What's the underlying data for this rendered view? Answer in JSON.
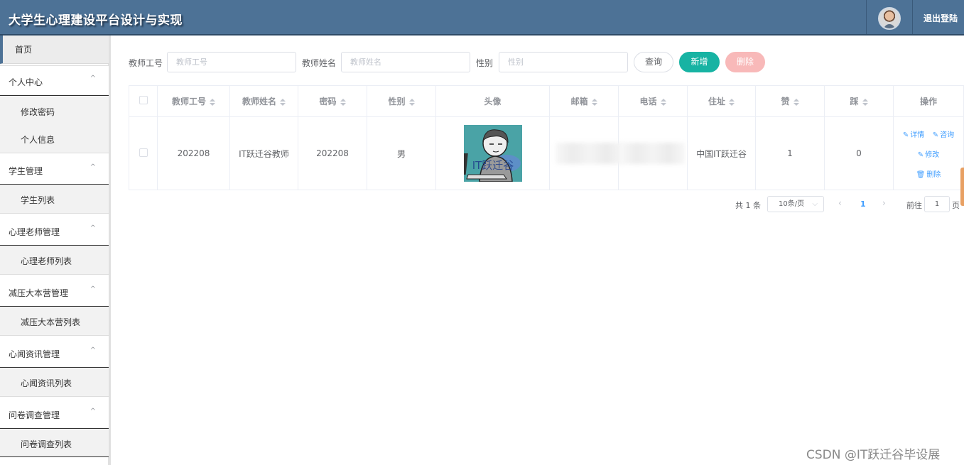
{
  "header": {
    "title": "大学生心理建设平台设计与实现",
    "logout_label": "退出登陆"
  },
  "sidebar": {
    "home": "首页",
    "groups": [
      {
        "label": "个人中心",
        "children": [
          "修改密码",
          "个人信息"
        ]
      },
      {
        "label": "学生管理",
        "children": [
          "学生列表"
        ]
      },
      {
        "label": "心理老师管理",
        "children": [
          "心理老师列表"
        ]
      },
      {
        "label": "减压大本营管理",
        "children": [
          "减压大本营列表"
        ]
      },
      {
        "label": "心闻资讯管理",
        "children": [
          "心闻资讯列表"
        ]
      },
      {
        "label": "问卷调查管理",
        "children": [
          "问卷调查列表"
        ]
      }
    ]
  },
  "search": {
    "fields": [
      {
        "label": "教师工号",
        "placeholder": "教师工号",
        "value": ""
      },
      {
        "label": "教师姓名",
        "placeholder": "教师姓名",
        "value": ""
      },
      {
        "label": "性别",
        "placeholder": "性别",
        "value": ""
      }
    ],
    "query_label": "查询",
    "add_label": "新增",
    "delete_label": "删除"
  },
  "table": {
    "columns": [
      "教师工号",
      "教师姓名",
      "密码",
      "性别",
      "头像",
      "邮箱",
      "电话",
      "住址",
      "赞",
      "踩",
      "操作"
    ],
    "rows": [
      {
        "teacher_id": "202208",
        "teacher_name": "IT跃迁谷教师",
        "password": "202208",
        "gender": "男",
        "avatar_caption": "IT跃迁谷",
        "email": "",
        "phone": "",
        "address": "中国IT跃迁谷",
        "likes": "1",
        "dislikes": "0",
        "actions": {
          "detail": "详情",
          "consult": "咨询",
          "edit": "修改",
          "delete": "删除"
        }
      }
    ]
  },
  "pagination": {
    "total_text": "共 1 条",
    "page_size": "10条/页",
    "current_page": "1",
    "goto_label": "前往",
    "goto_value": "1",
    "page_unit": "页"
  },
  "watermark": "CSDN @IT跃迁谷毕设展",
  "colors": {
    "header_bg": "#4d7296",
    "add_btn": "#17b3a3",
    "delete_btn": "#f8b9b9",
    "link": "#409eff"
  }
}
